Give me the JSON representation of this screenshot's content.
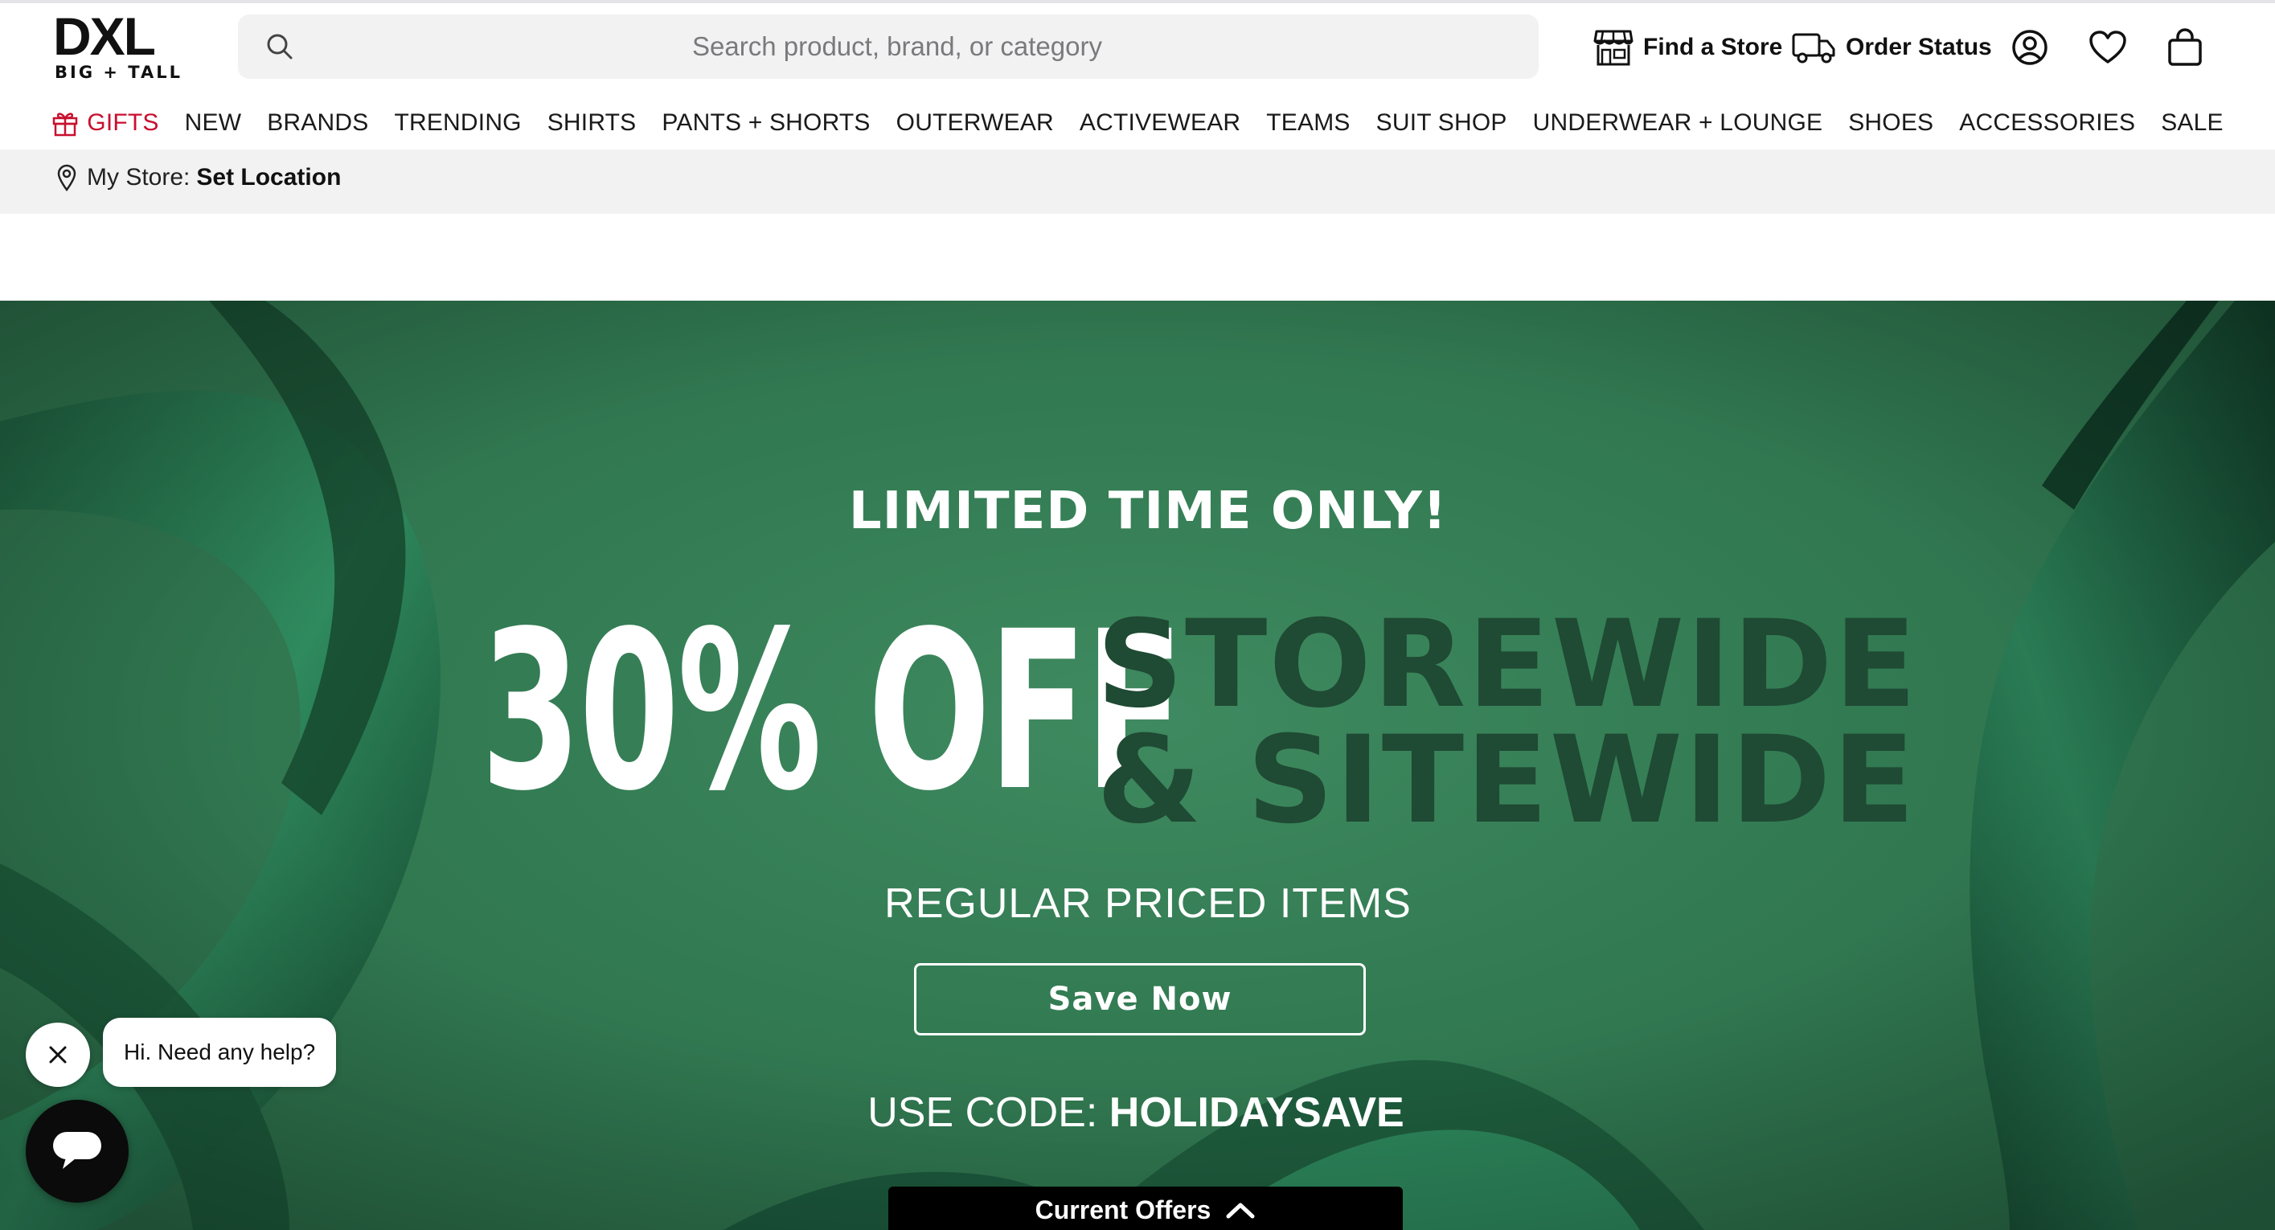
{
  "brand": {
    "name": "DXL",
    "tagline": "BIG + TALL"
  },
  "search": {
    "placeholder": "Search product, brand, or category",
    "icon": "search-icon"
  },
  "utility": {
    "find_store": "Find a Store",
    "order_status": "Order Status",
    "icons": [
      "store-icon",
      "truck-icon",
      "account-icon",
      "heart-icon",
      "bag-icon"
    ]
  },
  "nav": {
    "items": [
      "GIFTS",
      "NEW",
      "BRANDS",
      "TRENDING",
      "SHIRTS",
      "PANTS + SHORTS",
      "OUTERWEAR",
      "ACTIVEWEAR",
      "TEAMS",
      "SUIT SHOP",
      "UNDERWEAR + LOUNGE",
      "SHOES",
      "ACCESSORIES",
      "SALE"
    ],
    "highlight_color": "#c8102e"
  },
  "store": {
    "label": "My Store:",
    "value": "Set Location"
  },
  "hero": {
    "kicker": "LIMITED TIME ONLY!",
    "headline": "30% OFF",
    "line1": "STOREWIDE",
    "line2": "& SITEWIDE",
    "subhead": "REGULAR PRICED ITEMS",
    "cta": "Save Now",
    "code_label": "USE CODE:",
    "code_value": "HOLIDAYSAVE",
    "background_color": "#327a52",
    "accent_text_color": "#1f4a33"
  },
  "offers_tab": {
    "label": "Current Offers"
  },
  "chat": {
    "greeting": "Hi. Need any help?"
  }
}
